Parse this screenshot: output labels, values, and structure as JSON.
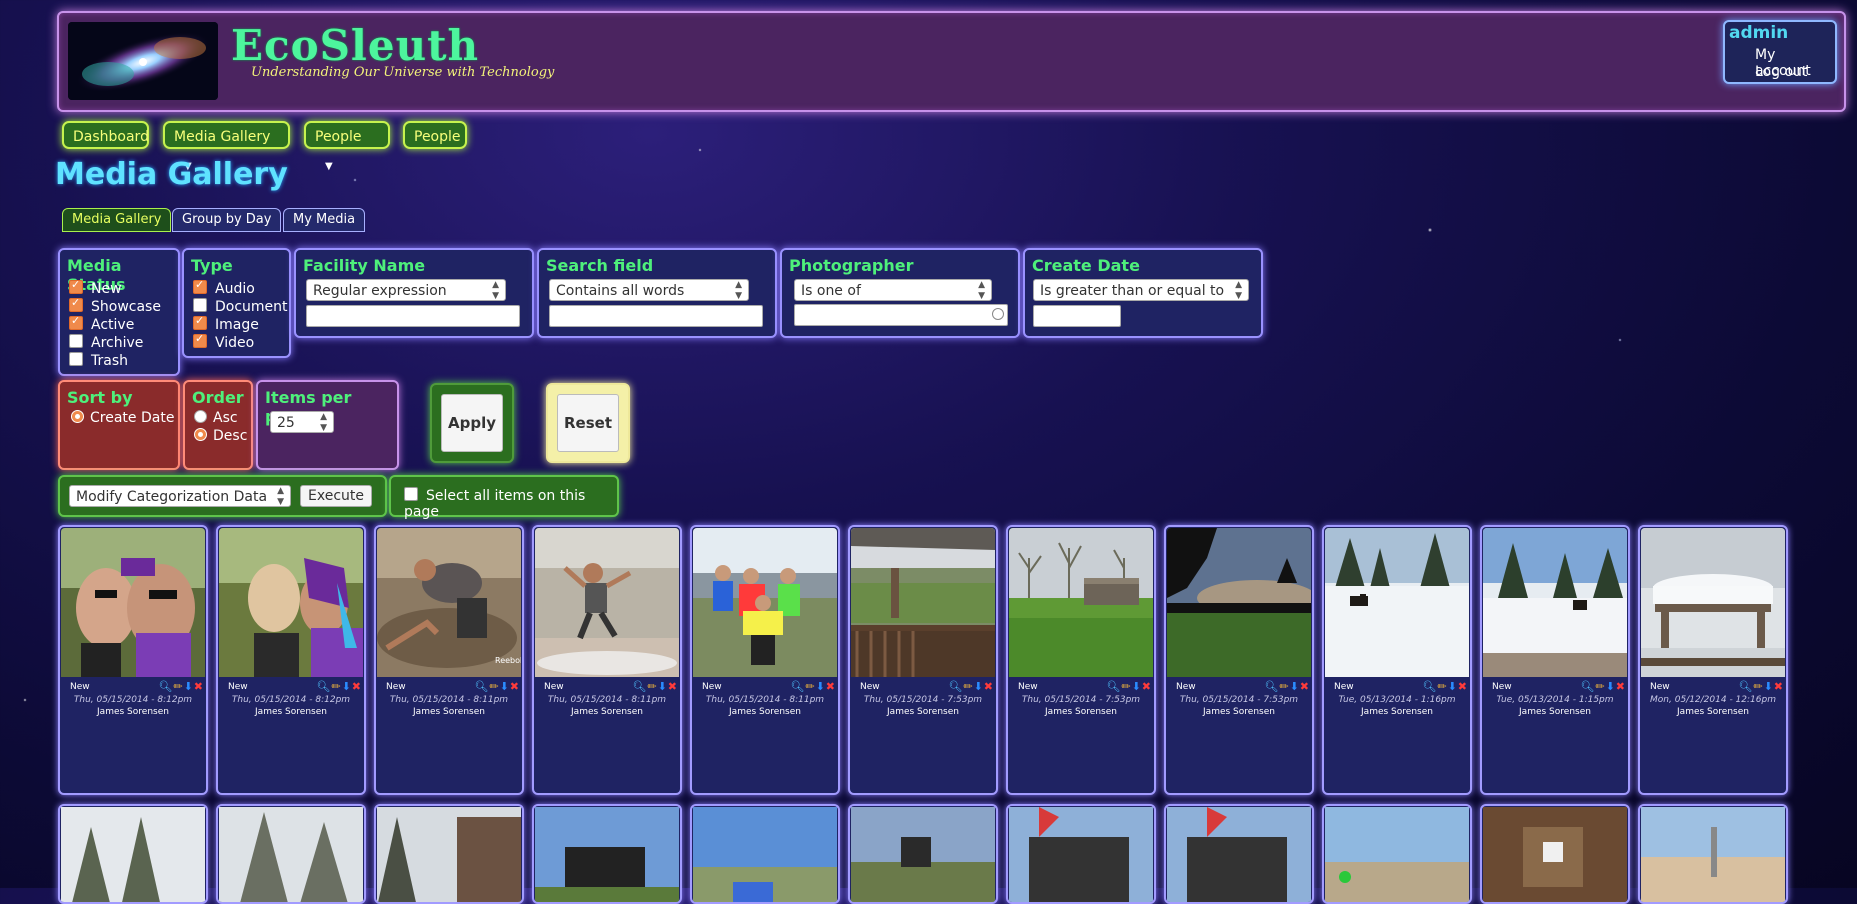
{
  "header": {
    "brand": "EcoSleuth",
    "tagline": "Understanding Our Universe with Technology",
    "user": "admin",
    "my_account": "My account",
    "logout": "Log out"
  },
  "nav": [
    {
      "label": "Dashboard"
    },
    {
      "label": "Media Gallery"
    },
    {
      "label": "People"
    },
    {
      "label": "People"
    }
  ],
  "page_title": "Media Gallery",
  "tabs": [
    {
      "label": "Media Gallery"
    },
    {
      "label": "Group by Day"
    },
    {
      "label": "My Media"
    }
  ],
  "filters": {
    "media_status": {
      "title": "Media Status",
      "options": [
        {
          "label": "New",
          "checked": true
        },
        {
          "label": "Showcase",
          "checked": true
        },
        {
          "label": "Active",
          "checked": true
        },
        {
          "label": "Archive",
          "checked": false
        },
        {
          "label": "Trash",
          "checked": false
        }
      ]
    },
    "type": {
      "title": "Type",
      "options": [
        {
          "label": "Audio",
          "checked": true
        },
        {
          "label": "Document",
          "checked": false
        },
        {
          "label": "Image",
          "checked": true
        },
        {
          "label": "Video",
          "checked": true
        }
      ]
    },
    "facility_name": {
      "title": "Facility Name",
      "operator": "Regular expression",
      "value": ""
    },
    "search_field": {
      "title": "Search field",
      "operator": "Contains all words",
      "value": ""
    },
    "photographer": {
      "title": "Photographer",
      "operator": "Is one of",
      "value": ""
    },
    "create_date": {
      "title": "Create Date",
      "operator": "Is greater than or equal to",
      "value": ""
    }
  },
  "sort": {
    "sort_by_title": "Sort by",
    "sort_by_option": "Create Date",
    "order_title": "Order",
    "asc": "Asc",
    "desc": "Desc",
    "items_title": "Items per page",
    "items_value": "25",
    "apply": "Apply",
    "reset": "Reset"
  },
  "bulk": {
    "operation": "Modify Categorization Data",
    "execute": "Execute",
    "select_all": "Select all items on this page"
  },
  "items": [
    {
      "status": "New",
      "date": "Thu, 05/15/2014 - 8:12pm",
      "author": "James Sorensen",
      "thumb": "party1"
    },
    {
      "status": "New",
      "date": "Thu, 05/15/2014 - 8:12pm",
      "author": "James Sorensen",
      "thumb": "party2"
    },
    {
      "status": "New",
      "date": "Thu, 05/15/2014 - 8:11pm",
      "author": "James Sorensen",
      "thumb": "mud"
    },
    {
      "status": "New",
      "date": "Thu, 05/15/2014 - 8:11pm",
      "author": "James Sorensen",
      "thumb": "jump"
    },
    {
      "status": "New",
      "date": "Thu, 05/15/2014 - 8:11pm",
      "author": "James Sorensen",
      "thumb": "group"
    },
    {
      "status": "New",
      "date": "Thu, 05/15/2014 - 7:53pm",
      "author": "James Sorensen",
      "thumb": "deck"
    },
    {
      "status": "New",
      "date": "Thu, 05/15/2014 - 7:53pm",
      "author": "James Sorensen",
      "thumb": "field"
    },
    {
      "status": "New",
      "date": "Thu, 05/15/2014 - 7:53pm",
      "author": "James Sorensen",
      "thumb": "dusk"
    },
    {
      "status": "New",
      "date": "Tue, 05/13/2014 - 1:16pm",
      "author": "James Sorensen",
      "thumb": "snow1"
    },
    {
      "status": "New",
      "date": "Tue, 05/13/2014 - 1:15pm",
      "author": "James Sorensen",
      "thumb": "snow2"
    },
    {
      "status": "New",
      "date": "Mon, 05/12/2014 - 12:16pm",
      "author": "James Sorensen",
      "thumb": "snowtable"
    }
  ],
  "thumb_icons": {
    "view": "magnifier-icon",
    "edit": "pencil-icon",
    "download": "download-icon",
    "delete": "delete-icon"
  }
}
